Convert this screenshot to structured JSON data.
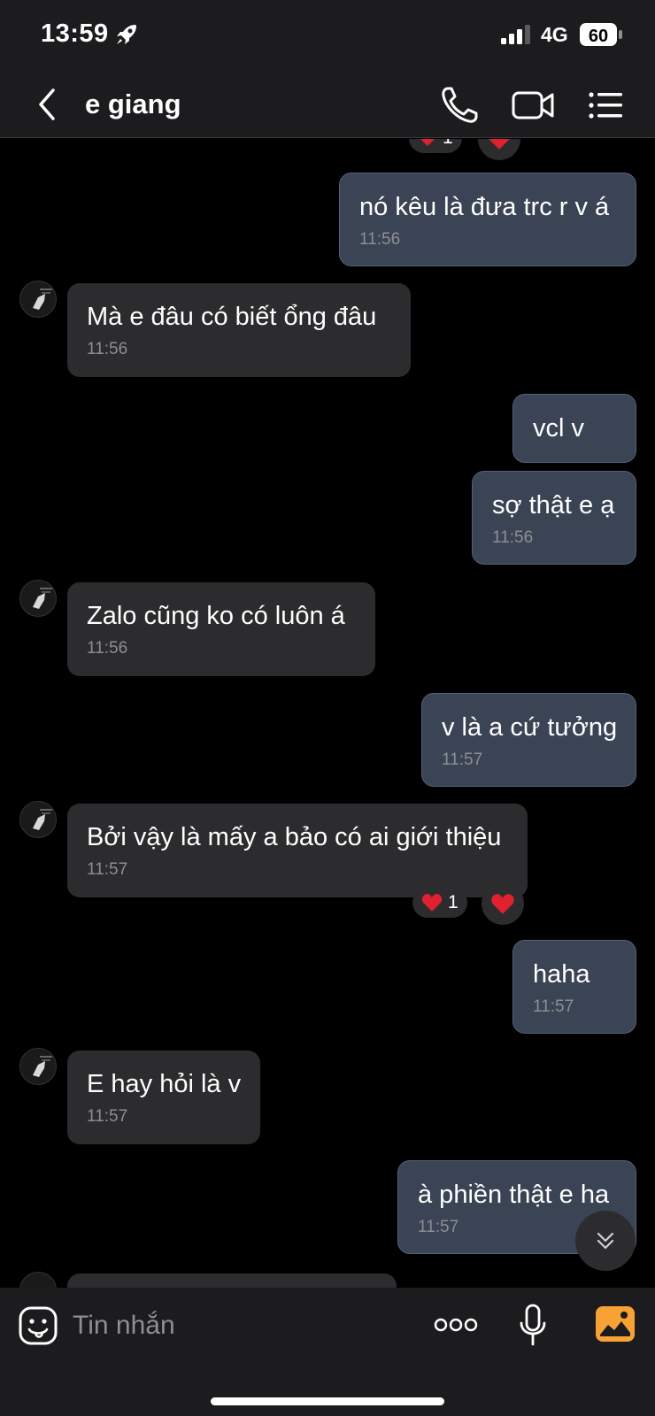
{
  "status_bar": {
    "time": "13:59",
    "network": "4G",
    "battery": "60"
  },
  "header": {
    "title": "e giang"
  },
  "messages": [
    {
      "text": "nó kêu là đưa trc r v á",
      "time": "11:56"
    },
    {
      "text": "Mà e đâu có biết ổng đâu",
      "time": "11:56"
    },
    {
      "text": "vcl v",
      "time": ""
    },
    {
      "text": "sợ thật e ạ",
      "time": "11:56"
    },
    {
      "text": "Zalo cũng ko có luôn á",
      "time": "11:56"
    },
    {
      "text": "v là a cứ tưởng",
      "time": "11:57"
    },
    {
      "text": "Bởi vậy là mấy a bảo có ai giới thiệu",
      "time": "11:57"
    },
    {
      "text": "haha",
      "time": "11:57"
    },
    {
      "text": "E hay hỏi là v",
      "time": "11:57"
    },
    {
      "text": "à phiền thật e ha",
      "time": "11:57"
    }
  ],
  "reactions": {
    "top_count": "1",
    "mid_count": "1"
  },
  "composer": {
    "placeholder": "Tin nhắn"
  },
  "colors": {
    "incoming_bubble": "#2c2c2e",
    "outgoing_bubble": "#3a4454",
    "reaction": "#e0212f",
    "photo_accent": "#f7a234"
  }
}
